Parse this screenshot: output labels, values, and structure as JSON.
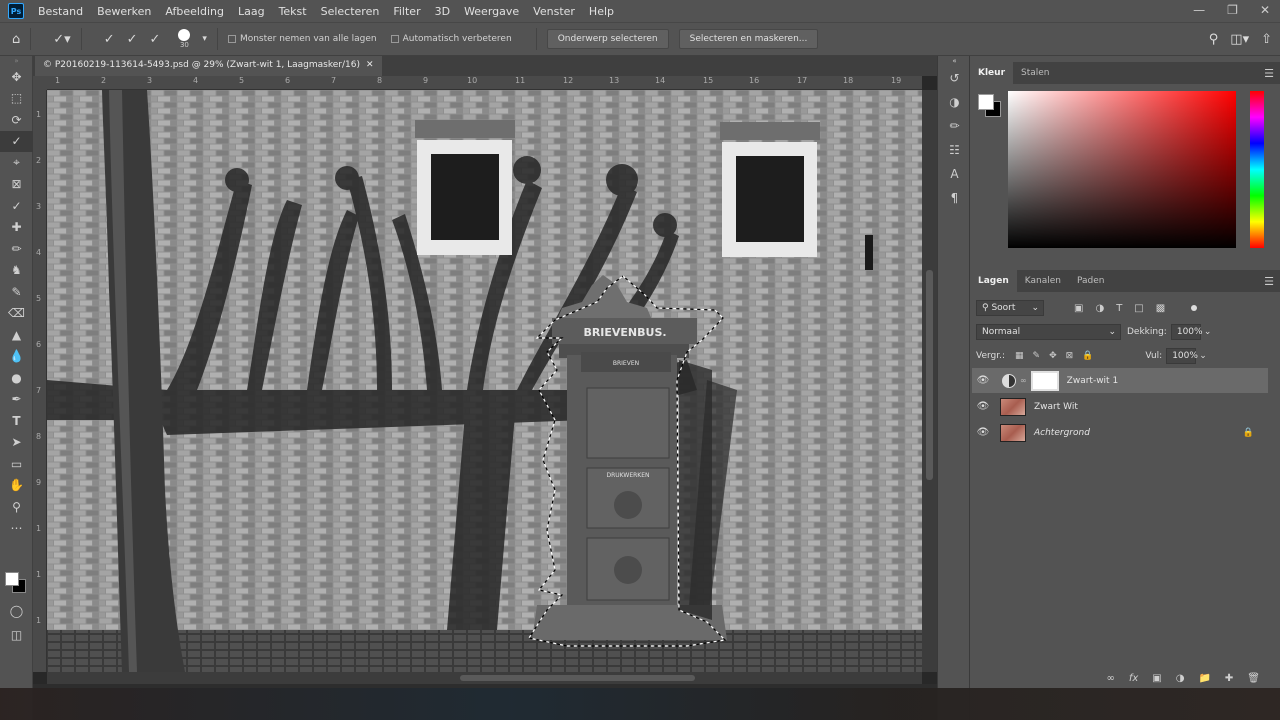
{
  "app": {
    "logo": "Ps"
  },
  "menu": [
    "Bestand",
    "Bewerken",
    "Afbeelding",
    "Laag",
    "Tekst",
    "Selecteren",
    "Filter",
    "3D",
    "Weergave",
    "Venster",
    "Help"
  ],
  "options": {
    "brush_size": "30",
    "sample_all_layers": "Monster nemen van alle lagen",
    "auto_enhance": "Automatisch verbeteren",
    "select_subject": "Onderwerp selecteren",
    "select_and_mask": "Selecteren en maskeren..."
  },
  "document": {
    "tab_title": "© P20160219-113614-5493.psd @ 29% (Zwart-wit 1, Laagmasker/16)",
    "ruler_h": [
      "1",
      "2",
      "3",
      "4",
      "5",
      "6",
      "7",
      "8",
      "9",
      "10",
      "11",
      "12",
      "13",
      "14",
      "15",
      "16",
      "17",
      "18",
      "19"
    ],
    "ruler_v": [
      "1",
      "2",
      "3",
      "4",
      "5",
      "6",
      "7",
      "8",
      "9",
      "1",
      "1",
      "1"
    ],
    "sign_top": "BRIEVENBUS.",
    "sign_brieven": "BRIEVEN",
    "sign_drukwerken": "DRUKWERKEN"
  },
  "color_panel": {
    "tabs": [
      "Kleur",
      "Stalen"
    ]
  },
  "layers_panel": {
    "tabs": [
      "Lagen",
      "Kanalen",
      "Paden"
    ],
    "filter": "Soort",
    "blend_mode": "Normaal",
    "opacity_label": "Dekking:",
    "opacity_value": "100%",
    "lock_label": "Vergr.:",
    "fill_label": "Vul:",
    "fill_value": "100%",
    "layers": [
      {
        "name": "Zwart-wit 1",
        "selected": true
      },
      {
        "name": "Zwart Wit",
        "selected": false
      },
      {
        "name": "Achtergrond",
        "selected": false
      }
    ]
  }
}
